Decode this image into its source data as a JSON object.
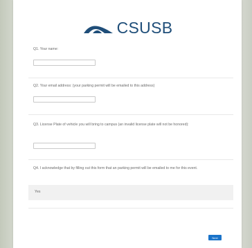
{
  "brand": {
    "name": "CSUSB",
    "color": "#1f4e79"
  },
  "questions": [
    {
      "label": "Q1. Your name:",
      "value": ""
    },
    {
      "label": "Q2. Your email address: (your parking permit will be emailed to this address)",
      "value": ""
    },
    {
      "label": "Q3. License Plate of vehicle you will bring to campus (an invalid license plate will not be honored):",
      "value": ""
    },
    {
      "label": "Q4. I acknowledge that by filling out this form that an parking permit will be emailed to me for this event.",
      "option": "Yes"
    }
  ],
  "actions": {
    "next_label": "Next",
    "next_color": "#1a73c9"
  }
}
